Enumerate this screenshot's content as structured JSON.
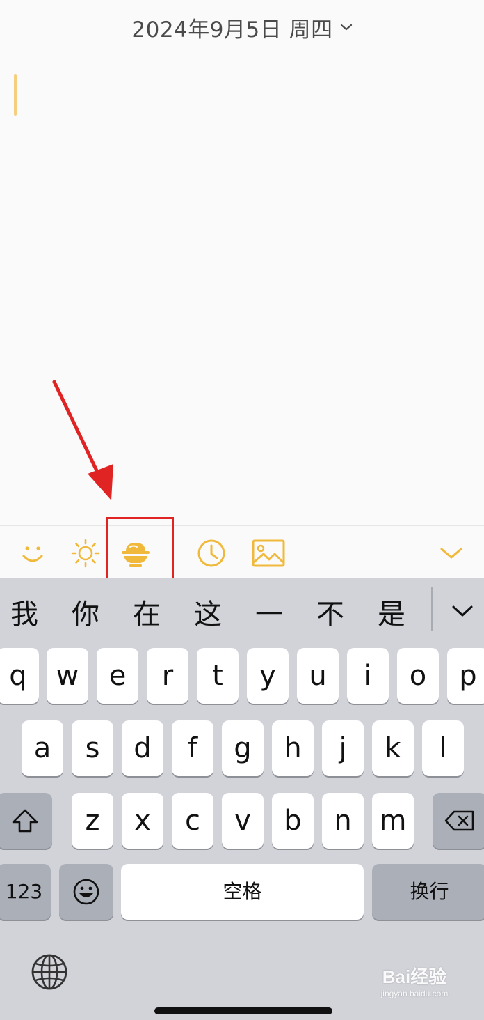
{
  "header": {
    "date": "2024年9月5日 周四"
  },
  "editor": {
    "content": ""
  },
  "toolbar": {
    "icons": [
      "smile-icon",
      "sun-icon",
      "bowl-icon",
      "clock-icon",
      "image-icon",
      "chevron-down-icon"
    ],
    "accent_color": "#f0b93b"
  },
  "annotation": {
    "arrow_color": "#e02424",
    "box_color": "#e02424"
  },
  "keyboard": {
    "candidates": [
      "我",
      "你",
      "在",
      "这",
      "一",
      "不",
      "是"
    ],
    "row1": [
      "q",
      "w",
      "e",
      "r",
      "t",
      "y",
      "u",
      "i",
      "o",
      "p"
    ],
    "row2": [
      "a",
      "s",
      "d",
      "f",
      "g",
      "h",
      "j",
      "k",
      "l"
    ],
    "row3": [
      "z",
      "x",
      "c",
      "v",
      "b",
      "n",
      "m"
    ],
    "numbers_key": "123",
    "space_key": "空格",
    "return_key": "换行"
  },
  "watermark": {
    "main": "Bai经验",
    "sub": "jingyan.baidu.com"
  }
}
